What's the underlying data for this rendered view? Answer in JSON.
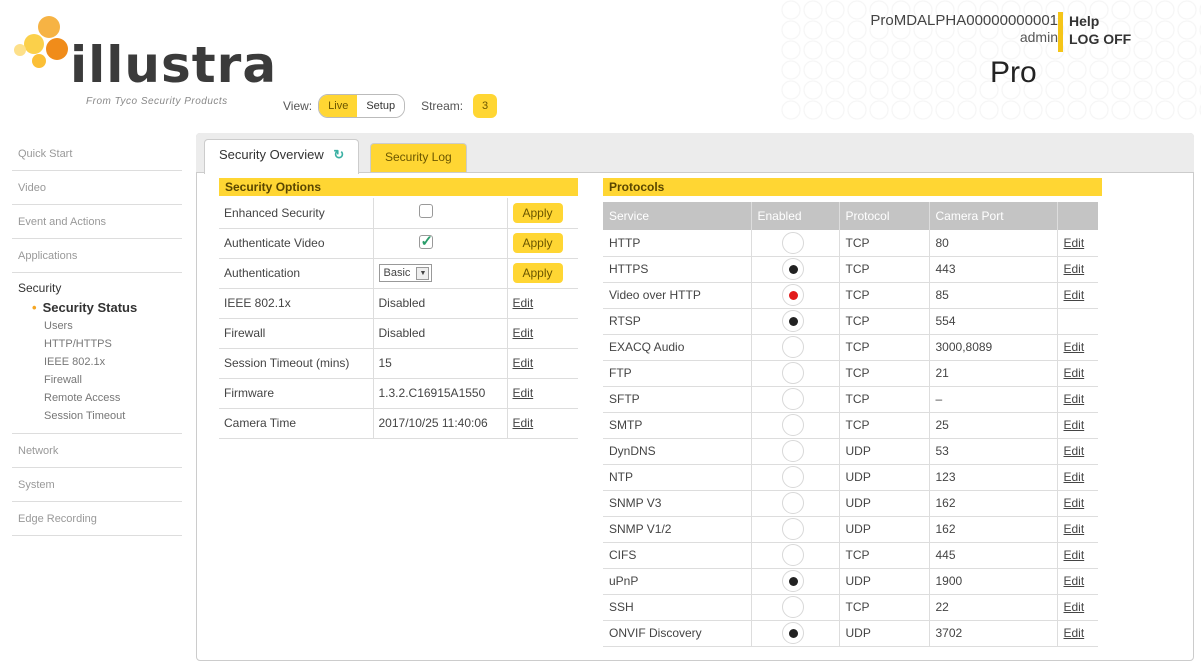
{
  "brand": {
    "logo": "illustra",
    "sub": "From Tyco Security Products"
  },
  "view": {
    "label": "View:",
    "live": "Live",
    "setup": "Setup",
    "stream_label": "Stream:",
    "stream_value": "3"
  },
  "user": {
    "device": "ProMDALPHA00000000001",
    "name": "admin",
    "edition": "Pro",
    "help": "Help",
    "logoff": "LOG OFF"
  },
  "nav": {
    "top": [
      "Quick Start",
      "Video",
      "Event and Actions",
      "Applications"
    ],
    "security": {
      "title": "Security",
      "items": [
        "Security Status",
        "Users",
        "HTTP/HTTPS",
        "IEEE 802.1x",
        "Firewall",
        "Remote Access",
        "Session Timeout"
      ]
    },
    "bottom": [
      "Network",
      "System",
      "Edge Recording"
    ]
  },
  "tabs": {
    "overview": "Security Overview",
    "log": "Security Log"
  },
  "options": {
    "title": "Security Options",
    "apply": "Apply",
    "edit": "Edit",
    "enhanced": "Enhanced Security",
    "authvideo": "Authenticate Video",
    "auth": "Authentication",
    "auth_value": "Basic",
    "rows": [
      {
        "label": "IEEE 802.1x",
        "value": "Disabled"
      },
      {
        "label": "Firewall",
        "value": "Disabled"
      },
      {
        "label": "Session Timeout (mins)",
        "value": "15"
      },
      {
        "label": "Firmware",
        "value": "1.3.2.C16915A1550"
      },
      {
        "label": "Camera Time",
        "value": "2017/10/25 11:40:06"
      }
    ]
  },
  "protocols": {
    "title": "Protocols",
    "headers": [
      "Service",
      "Enabled",
      "Protocol",
      "Camera Port"
    ],
    "edit": "Edit",
    "rows": [
      {
        "service": "HTTP",
        "enabled": "off",
        "protocol": "TCP",
        "port": "80",
        "edit": true
      },
      {
        "service": "HTTPS",
        "enabled": "on",
        "protocol": "TCP",
        "port": "443",
        "edit": true
      },
      {
        "service": "Video over HTTP",
        "enabled": "red",
        "protocol": "TCP",
        "port": "85",
        "edit": true
      },
      {
        "service": "RTSP",
        "enabled": "on",
        "protocol": "TCP",
        "port": "554",
        "edit": false
      },
      {
        "service": "EXACQ Audio",
        "enabled": "off",
        "protocol": "TCP",
        "port": "3000,8089",
        "edit": true
      },
      {
        "service": "FTP",
        "enabled": "off",
        "protocol": "TCP",
        "port": "21",
        "edit": true
      },
      {
        "service": "SFTP",
        "enabled": "off",
        "protocol": "TCP",
        "port": "–",
        "edit": true
      },
      {
        "service": "SMTP",
        "enabled": "off",
        "protocol": "TCP",
        "port": "25",
        "edit": true
      },
      {
        "service": "DynDNS",
        "enabled": "off",
        "protocol": "UDP",
        "port": "53",
        "edit": true
      },
      {
        "service": "NTP",
        "enabled": "off",
        "protocol": "UDP",
        "port": "123",
        "edit": true
      },
      {
        "service": "SNMP V3",
        "enabled": "off",
        "protocol": "UDP",
        "port": "162",
        "edit": true
      },
      {
        "service": "SNMP V1/2",
        "enabled": "off",
        "protocol": "UDP",
        "port": "162",
        "edit": true
      },
      {
        "service": "CIFS",
        "enabled": "off",
        "protocol": "TCP",
        "port": "445",
        "edit": true
      },
      {
        "service": "uPnP",
        "enabled": "on",
        "protocol": "UDP",
        "port": "1900",
        "edit": true
      },
      {
        "service": "SSH",
        "enabled": "off",
        "protocol": "TCP",
        "port": "22",
        "edit": true
      },
      {
        "service": "ONVIF Discovery",
        "enabled": "on",
        "protocol": "UDP",
        "port": "3702",
        "edit": true
      }
    ]
  },
  "colors": {
    "accent": "#ffd633",
    "logo_orange": "#f5a623",
    "header_grey": "#c4c4c4",
    "red": "#e21b1b"
  }
}
